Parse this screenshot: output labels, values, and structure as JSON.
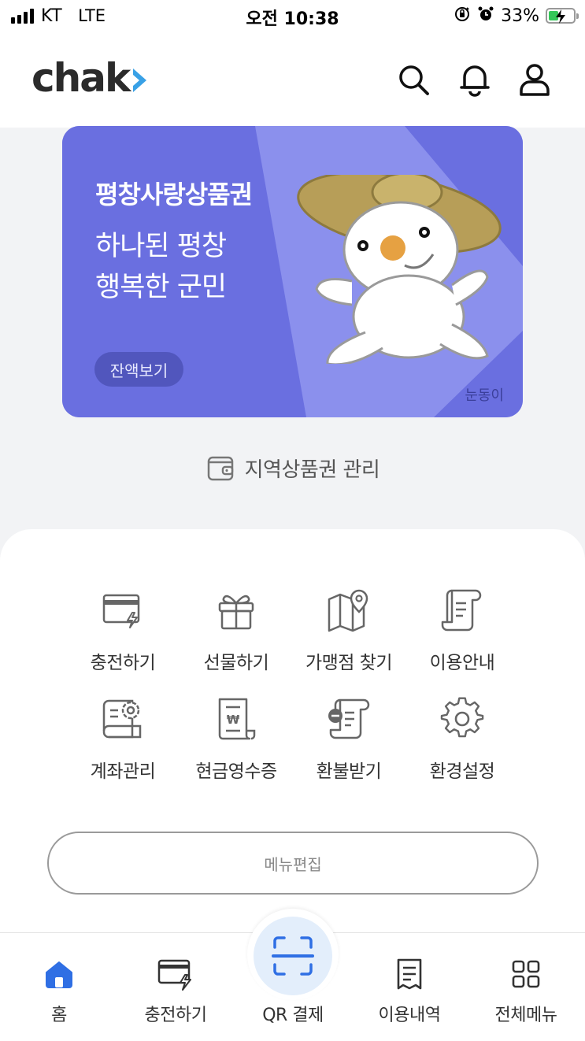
{
  "status_bar": {
    "carrier": "KT",
    "network": "LTE",
    "time": "오전 10:38",
    "battery_percent": "33%",
    "icons": [
      "signal-icon",
      "orientation-lock-icon",
      "alarm-icon",
      "battery-charging-icon"
    ]
  },
  "header": {
    "logo_text": "chak",
    "icons": [
      "search-icon",
      "bell-icon",
      "user-icon"
    ]
  },
  "banner": {
    "title": "평창사랑상품권",
    "line1": "하나된 평창",
    "line2": "행복한 군민",
    "balance_button": "잔액보기",
    "mascot_name": "눈동이",
    "colors": {
      "background": "#6a6fe0",
      "stripe": "#8e93ee"
    }
  },
  "voucher_manage": {
    "label": "지역상품권 관리",
    "icon": "wallet-icon"
  },
  "menu": {
    "items": [
      {
        "label": "충전하기",
        "icon": "charge-card-icon"
      },
      {
        "label": "선물하기",
        "icon": "gift-icon"
      },
      {
        "label": "가맹점 찾기",
        "icon": "map-pin-icon"
      },
      {
        "label": "이용안내",
        "icon": "guide-document-icon"
      },
      {
        "label": "계좌관리",
        "icon": "account-settings-icon"
      },
      {
        "label": "현금영수증",
        "icon": "receipt-won-icon"
      },
      {
        "label": "환불받기",
        "icon": "refund-icon"
      },
      {
        "label": "환경설정",
        "icon": "gear-icon"
      }
    ],
    "edit_button": "메뉴편집"
  },
  "bottom_nav": {
    "items": [
      {
        "label": "홈",
        "icon": "home-icon",
        "active": true
      },
      {
        "label": "충전하기",
        "icon": "charge-card-icon",
        "active": false
      },
      {
        "label": "QR 결제",
        "icon": "qr-scan-icon",
        "active": false
      },
      {
        "label": "이용내역",
        "icon": "history-receipt-icon",
        "active": false
      },
      {
        "label": "전체메뉴",
        "icon": "grid-menu-icon",
        "active": false
      }
    ],
    "colors": {
      "active": "#2f6fe4",
      "qr_circle": "#e3eefb"
    }
  }
}
